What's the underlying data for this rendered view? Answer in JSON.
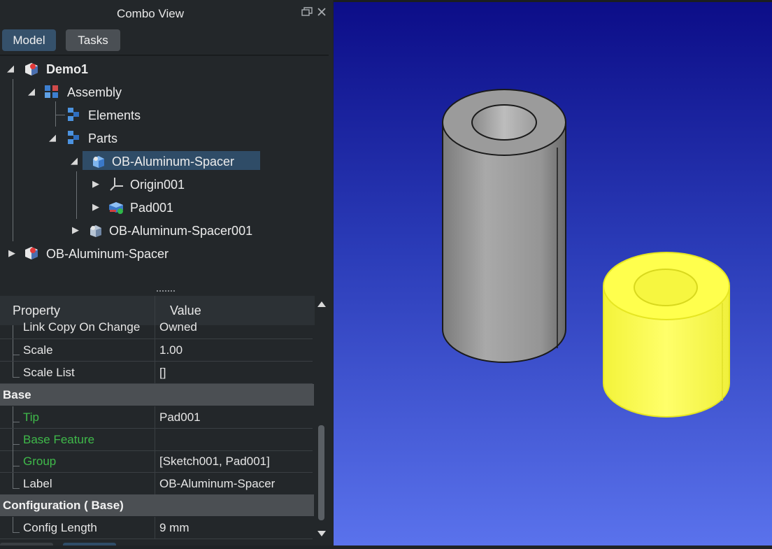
{
  "panel": {
    "title": "Combo View",
    "tabs": [
      {
        "label": "Model",
        "active": true
      },
      {
        "label": "Tasks",
        "active": false
      }
    ]
  },
  "tree": {
    "items": [
      {
        "label": "Demo1",
        "bold": true,
        "icon": "document-icon"
      },
      {
        "label": "Assembly",
        "icon": "assembly-icon"
      },
      {
        "label": "Elements",
        "icon": "elements-icon"
      },
      {
        "label": "Parts",
        "icon": "parts-icon"
      },
      {
        "label": "OB-Aluminum-Spacer",
        "icon": "body-icon",
        "selected": true
      },
      {
        "label": "Origin001",
        "icon": "origin-icon"
      },
      {
        "label": "Pad001",
        "icon": "pad-icon"
      },
      {
        "label": "OB-Aluminum-Spacer001",
        "icon": "body-icon"
      },
      {
        "label": "OB-Aluminum-Spacer",
        "icon": "document-icon"
      }
    ]
  },
  "properties": {
    "header": {
      "property": "Property",
      "value": "Value"
    },
    "rows": [
      {
        "name": "Link Copy On Change",
        "value": "Owned"
      },
      {
        "name": "Scale",
        "value": "1.00"
      },
      {
        "name": "Scale List",
        "value": "[]"
      }
    ],
    "group_base": "Base",
    "base_rows": [
      {
        "name": "Tip",
        "value": "Pad001",
        "green": true
      },
      {
        "name": "Base Feature",
        "value": "",
        "green": true
      },
      {
        "name": "Group",
        "value": "[Sketch001, Pad001]",
        "green": true
      },
      {
        "name": "Label",
        "value": "OB-Aluminum-Spacer",
        "green": false
      }
    ],
    "group_config": "Configuration ( Base)",
    "config_rows": [
      {
        "name": "Config Length",
        "value": "9 mm"
      }
    ]
  },
  "colors": {
    "selection": "#2f4c67",
    "gray_part": "#9a9a9a",
    "highlight_part": "#ffff4d",
    "viewport_top": "#0c0d88",
    "viewport_bottom": "#5a72ec",
    "green_text": "#3fb94a"
  }
}
